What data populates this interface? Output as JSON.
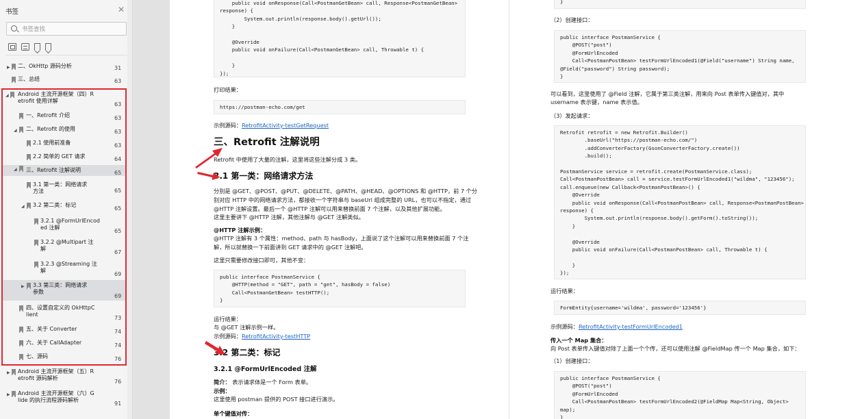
{
  "sidebar": {
    "title": "书签",
    "search_placeholder": "书签查找",
    "items": [
      {
        "label": "二、OkHttp 源码分析",
        "page": "31"
      },
      {
        "label": "三、总结",
        "page": "63"
      },
      {
        "label": "Android 主流开源框架（四）R",
        "label2": "etrofit 使用详解",
        "page": "63"
      },
      {
        "label": "一、Retrofit 介绍",
        "page": "63"
      },
      {
        "label": "二、Retrofit 的使用",
        "page": "63"
      },
      {
        "label": "2.1 使用前准备",
        "page": "63"
      },
      {
        "label": "2.2 简单的 GET 请求",
        "page": "64"
      },
      {
        "label": "三、Retrofit 注解说明",
        "page": "65"
      },
      {
        "label": "3.1 第一类：网络请求",
        "label2": "方法",
        "page": "65"
      },
      {
        "label": "3.2 第二类：标记",
        "page": "65"
      },
      {
        "label": "3.2.1 @FormUrlEncod",
        "label2": "ed 注解",
        "page": "65"
      },
      {
        "label": "3.2.2 @Multipart 注",
        "label2": "解",
        "page": "67"
      },
      {
        "label": "3.2.3 @Streaming 注",
        "label2": "解",
        "page": "69"
      },
      {
        "label": "3.3 第三类：网络请求",
        "label2": "参数",
        "page": "69"
      },
      {
        "label": "四、设置自定义的 OkHttpC",
        "label2": "lient",
        "page": "73"
      },
      {
        "label": "五、关于 Converter",
        "page": "74"
      },
      {
        "label": "六、关于 CallAdapter",
        "page": "74"
      },
      {
        "label": "七、源码",
        "page": "76"
      },
      {
        "label": "Android 主流开源框架（五）R",
        "label2": "etrofit 源码解析",
        "page": "76"
      },
      {
        "label": "Android 主流开源框架（六）G",
        "label2": "lide 的执行流程源码解析",
        "page": "91"
      }
    ]
  },
  "page1": {
    "code1": "    public void onResponse(Call<PostmanGetBean> call, Response<PostmanGetBean>\nresponse) {\n        System.out.println(response.body().getUrl());\n    }\n\n    @Override\n    public void onFailure(Call<PostmanGetBean> call, Throwable t) {\n\n    }\n});",
    "print_result": "打印结果：",
    "code2": "https://postman-echo.com/get",
    "sample_prefix": "示例源码：",
    "sample_link1": "RetrofitActivity-testGetRequest",
    "h_section3": "三、Retrofit 注解说明",
    "p_intro": "Retrofit 中使用了大量的注解，这里将这些注解分成 3 类。",
    "h_31": "3.1 第一类：网络请求方法",
    "p_31_l1": "分别是 @GET、@POST、@PUT、@DELETE、@PATH、@HEAD、@OPTIONS 和 @HTTP，前 7 个分",
    "p_31_l2": "别对应 HTTP 中的网络请求方法，都接收一个字符串与 baseUrl 组成完整的 URL，也可以不指定，通过",
    "p_31_l3": "@HTTP 注解设置。最后一个 @HTTP 注解可以用来替换前面 7 个注解，以及其他扩展功能。",
    "p_31_l4": "这里主要讲下 @HTTP 注解，其他注解与 @GET 注解类似。",
    "http_example_title": "@HTTP 注解示例：",
    "p_http_l1": "@HTTP 注解有 3 个属性：method、path 与 hasBody，上面说了这个注解可以用来替换前面 7 个注",
    "p_http_l2": "解，所以就替换一下前面讲到 GET 请求中的 @GET 注解吧。",
    "p_modify": "这里只需要修改接口即可，其他不变：",
    "code3": "public interface PostmanService {\n    @HTTP(method = \"GET\", path = \"get\", hasBody = false)\n    Call<PostmanGetBean> testHTTP();\n}",
    "run_result": "运行结果：",
    "run_same": "与 @GET 注解示例一样。",
    "sample_link2": "RetrofitActivity-testHTTP",
    "h_32": "3.2 第二类：标记",
    "h_321": "3.2.1 @FormUrlEncoded 注解",
    "brief_label": "简介：",
    "brief_text": "表示请求体是一个 Form 表单。",
    "example_label": "示例：",
    "p_postman": "这里使用 postman 提供的 POST 接口进行演示。",
    "single_kv": "单个键值对传："
  },
  "page2": {
    "code0": "}",
    "step2": "（2）创建接口：",
    "code1": "public interface PostmanService {\n    @POST(\"post\")\n    @FormUrlEncoded\n    Call<PostmanPostBean> testFormUrlEncoded1(@Field(\"username\") String name,\n@Field(\"password\") String password);\n}",
    "p_field_l1": "可以看到，这里使用了 @Field 注解，它属于第三类注解，用来向 Post 表单传入键值对，其中",
    "p_field_l2": "username 表示键，name 表示值。",
    "step3": "（3）发起请求：",
    "code2": "Retrofit retrofit = new Retrofit.Builder()\n        .baseUrl(\"https://postman-echo.com/\")\n        .addConverterFactory(GsonConverterFactory.create())\n        .build();\n\nPostmanService service = retrofit.create(PostmanService.class);\nCall<PostmanPostBean> call = service.testFormUrlEncoded1(\"wildma\", \"123456\");\ncall.enqueue(new Callback<PostmanPostBean>() {\n    @Override\n    public void onResponse(Call<PostmanPostBean> call, Response<PostmanPostBean>\nresponse) {\n        System.out.println(response.body().getForm().toString());\n    }\n\n    @Override\n    public void onFailure(Call<PostmanPostBean> call, Throwable t) {\n\n    }\n});",
    "run_result": "运行结果：",
    "code3": "FormEntity{username='wildma', password='123456'}",
    "sample_prefix": "示例源码：",
    "sample_link": "RetrofitActivity-testFormUrlEncoded1",
    "map_title": "传入一个 Map 集合：",
    "map_text": "向 Post 表单传入键值对除了上面一个个传，还可以使用注解 @FieldMap 传一个 Map 集合，如下：",
    "step1": "（1）创建接口：",
    "code4": "public interface PostmanService {\n    @POST(\"post\")\n    @FormUrlEncoded\n    Call<PostmanPostBean> testFormUrlEncoded2(@FieldMap Map<String, Object>\nmap);\n}"
  },
  "colors": {
    "highlight": "#e3262d",
    "link": "#1a63c7"
  }
}
